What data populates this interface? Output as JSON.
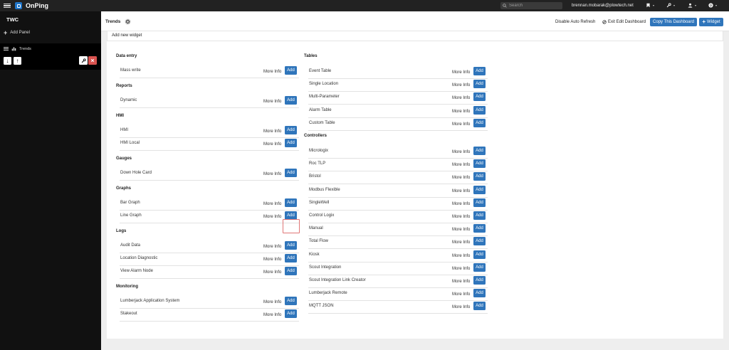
{
  "app": {
    "brand": "OnPing"
  },
  "topbar": {
    "search_placeholder": "Search",
    "user_email": "brennan.mobarak@plowtech.net",
    "icons": [
      "bookmark-icon",
      "wrench-icon",
      "user-icon",
      "help-icon"
    ]
  },
  "sidebar": {
    "workspace": "TWC",
    "add_panel": "Add Panel",
    "panel": {
      "label": "Trends",
      "up_arrow": "↑",
      "down_arrow": "↓"
    }
  },
  "header": {
    "title": "Trends",
    "disable_auto_refresh": "Disable Auto Refresh",
    "exit_edit": "Exit Edit Dashboard",
    "copy_dashboard": "Copy This Dashboard",
    "widget_button": "Widget"
  },
  "add_widget_bar": "Add new widget",
  "common": {
    "more_info": "More Info",
    "add": "Add"
  },
  "left_sections": [
    {
      "title": "Data entry",
      "items": [
        "Mass write"
      ]
    },
    {
      "title": "Reports",
      "items": [
        "Dynamic"
      ]
    },
    {
      "title": "HMI",
      "items": [
        "HMI",
        "HMI Local"
      ]
    },
    {
      "title": "Gauges",
      "items": [
        "Down Hole Card"
      ]
    },
    {
      "title": "Graphs",
      "items": [
        "Bar Graph",
        "Line Graph"
      ]
    },
    {
      "title": "Logs",
      "items": [
        "Audit Data",
        "Location Diagnostic",
        "View Alarm Node"
      ]
    },
    {
      "title": "Monitoring",
      "items": [
        "Lumberjack Application System",
        "Stakeout"
      ]
    }
  ],
  "right_sections": [
    {
      "title": "Tables",
      "items": [
        "Event Table",
        "Single Location",
        "Multi-Parameter",
        "Alarm Table",
        "Custom Table"
      ]
    },
    {
      "title": "Controllers",
      "items": [
        "Micrologix",
        "Roc TLP",
        "Bristol",
        "Modbus Flexible",
        "SingleWell",
        "Control Logix",
        "Manual",
        "Total Flow",
        "Kiosk",
        "Scout Integration",
        "Scout Integration Link Creator",
        "Lumberjack Remote",
        "MQTT JSON"
      ]
    }
  ],
  "colors": {
    "accent": "#2f75bb",
    "delete": "#d9534f",
    "topbar": "#222222",
    "sidebar": "#111111"
  }
}
